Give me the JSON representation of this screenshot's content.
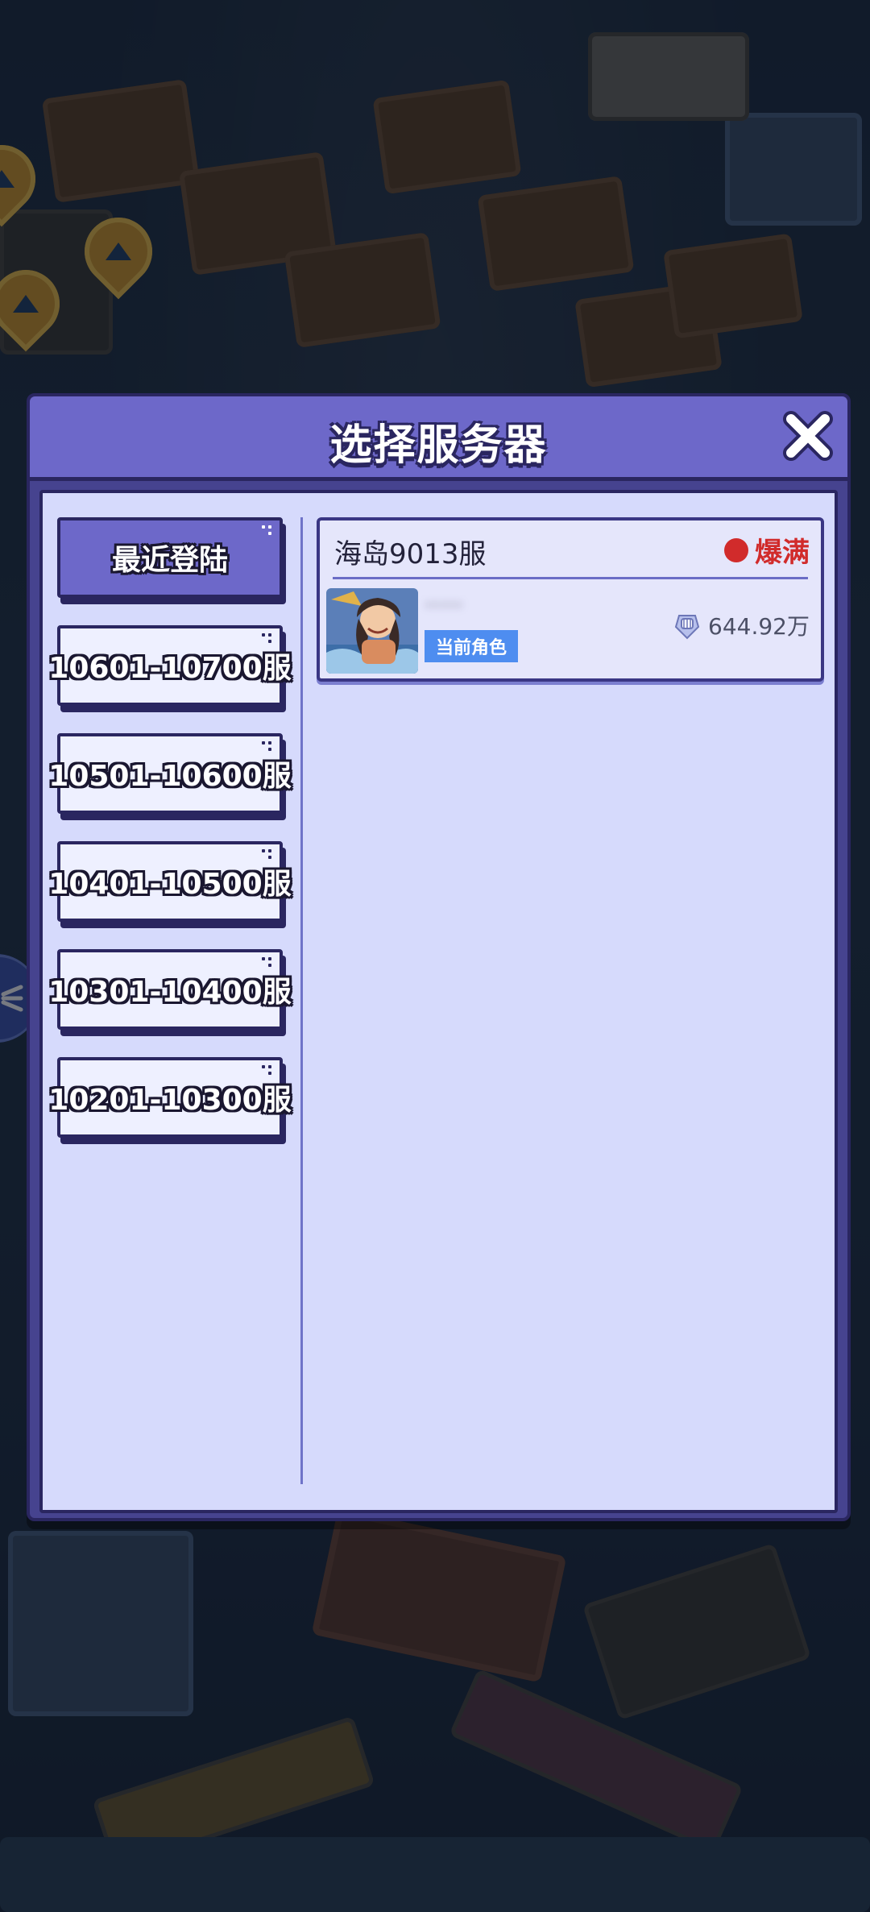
{
  "modal": {
    "title": "选择服务器"
  },
  "categories": [
    {
      "label": "最近登陆",
      "active": true
    },
    {
      "label": "10601-10700服",
      "active": false
    },
    {
      "label": "10501-10600服",
      "active": false
    },
    {
      "label": "10401-10500服",
      "active": false
    },
    {
      "label": "10301-10400服",
      "active": false
    },
    {
      "label": "10201-10300服",
      "active": false
    }
  ],
  "server": {
    "name": "海岛9013服",
    "status": "爆满",
    "status_color": "#d12b2b",
    "character_name": "·····",
    "role_badge": "当前角色",
    "power": "644.92万"
  },
  "icons": {
    "close": "close-icon",
    "power": "fist-icon",
    "side_tab": "chevron-menu-icon"
  },
  "colors": {
    "header": "#6d68c9",
    "panel": "#d6dafc",
    "border": "#2a2660",
    "badge": "#4e8df0"
  }
}
